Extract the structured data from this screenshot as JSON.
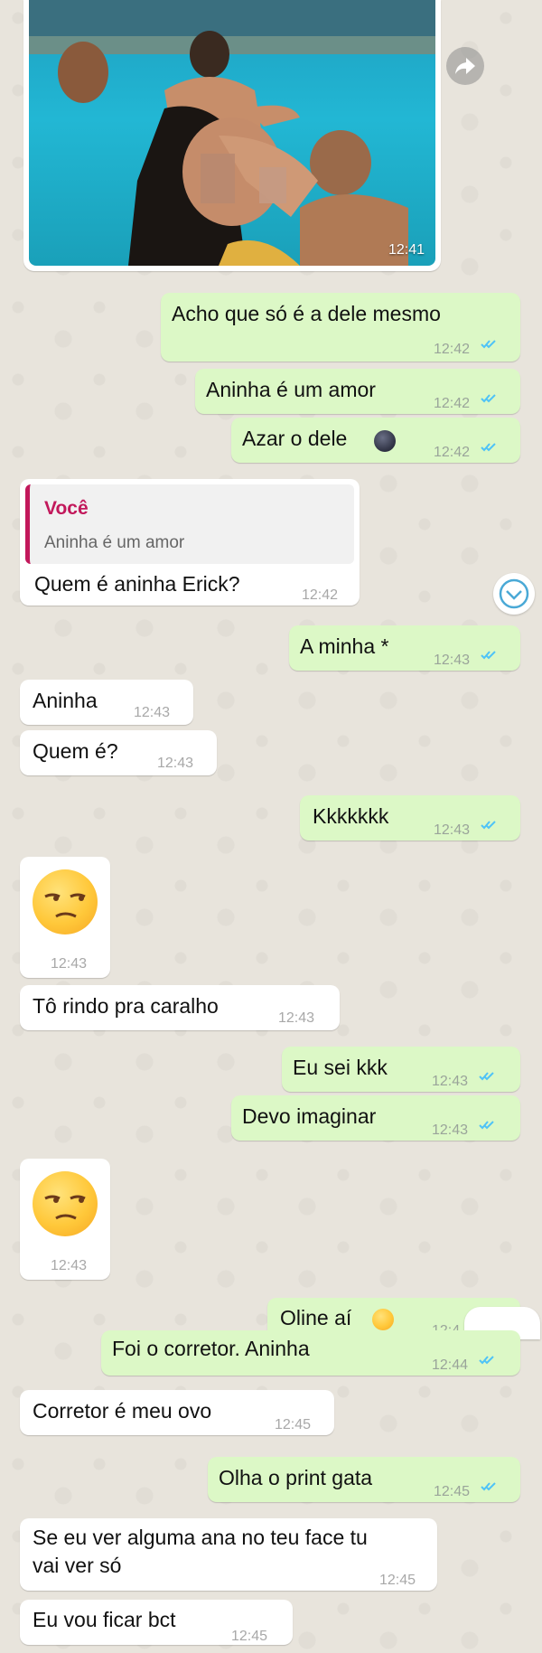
{
  "photo": {
    "time": "12:41"
  },
  "messages": [
    {
      "text": "Acho que só é a dele mesmo",
      "time": "12:42"
    },
    {
      "text": "Aninha é um amor",
      "time": "12:42"
    },
    {
      "text": "Azar o dele",
      "time": "12:42"
    },
    {
      "quote_author": "Você",
      "quote_text": "Aninha é um amor",
      "text": "Quem é aninha Erick?",
      "time": "12:42"
    },
    {
      "text": "A minha *",
      "time": "12:43"
    },
    {
      "text": "Aninha",
      "time": "12:43"
    },
    {
      "text": "Quem é?",
      "time": "12:43"
    },
    {
      "text": "Kkkkkkk",
      "time": "12:43"
    },
    {
      "emoji": "unamused-face",
      "time": "12:43"
    },
    {
      "text": "Tô rindo pra caralho",
      "time": "12:43"
    },
    {
      "text": "Eu sei kkk",
      "time": "12:43"
    },
    {
      "text": "Devo imaginar",
      "time": "12:43"
    },
    {
      "emoji": "unamused-face",
      "time": "12:43"
    },
    {
      "text": "Oline aí",
      "time": "12:4"
    },
    {
      "text": "Foi o corretor. Aninha",
      "time": "12:44"
    },
    {
      "text": "Corretor é meu ovo",
      "time": "12:45"
    },
    {
      "text": "Olha o print gata",
      "time": "12:45"
    },
    {
      "text_line1": "Se eu ver alguma ana no teu face tu",
      "text_line2": "vai ver só",
      "time": "12:45"
    },
    {
      "text": "Eu vou ficar bct",
      "time": "12:45"
    }
  ],
  "colors": {
    "outgoing_bubble": "#dcf8c6",
    "incoming_bubble": "#ffffff",
    "read_ticks": "#4fc3f7",
    "quote_accent": "#c2185b",
    "background": "#e8e4dc"
  },
  "icons": [
    "forward-icon",
    "scroll-down-icon",
    "read-receipt-icon",
    "new-moon-face-emoji",
    "thinking-face-emoji",
    "unamused-face-emoji"
  ]
}
